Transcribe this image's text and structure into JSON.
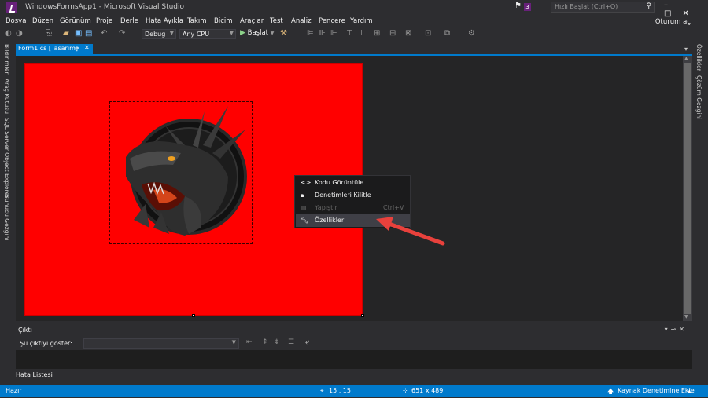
{
  "titlebar": {
    "title": "WindowsFormsApp1 - Microsoft Visual Studio",
    "notification_count": "3",
    "quick_launch_placeholder": "Hızlı Başlat (Ctrl+Q)",
    "signin": "Oturum aç"
  },
  "menu": [
    "Dosya",
    "Düzen",
    "Görünüm",
    "Proje",
    "Derle",
    "Hata Ayıkla",
    "Takım",
    "Biçim",
    "Araçlar",
    "Test",
    "Analiz",
    "Pencere",
    "Yardım"
  ],
  "toolbar": {
    "configuration": "Debug",
    "platform": "Any CPU",
    "start_label": "Başlat"
  },
  "left_rail": [
    "Bildirimler",
    "Araç Kutusu",
    "SQL Server Object Explorer",
    "Sunucu Gezgini"
  ],
  "right_rail": [
    "Özellikler",
    "Çözüm Gezgini"
  ],
  "document_tab": {
    "label": "Form1.cs [Tasarım]"
  },
  "context_menu": [
    {
      "label": "Kodu Görüntüle",
      "icon": "code-brackets-icon",
      "shortcut": "",
      "enabled": true
    },
    {
      "label": "Denetimleri Kilitle",
      "icon": "lock-icon",
      "shortcut": "",
      "enabled": true
    },
    {
      "label": "Yapıştır",
      "icon": "paste-icon",
      "shortcut": "Ctrl+V",
      "enabled": false
    },
    {
      "label": "Özellikler",
      "icon": "wrench-icon",
      "shortcut": "",
      "enabled": true
    }
  ],
  "output": {
    "title": "Çıktı",
    "show_from_label": "Şu çıktıyı göster:",
    "show_from_value": ""
  },
  "error_list_tab": "Hata Listesi",
  "statusbar": {
    "status": "Hazır",
    "position": "15 , 15",
    "size": "651 x 489",
    "source_control": "Kaynak Denetimine Ekle"
  },
  "colors": {
    "accent": "#007acc",
    "form_background": "#ff0000",
    "annotation_arrow": "#e8413c"
  }
}
